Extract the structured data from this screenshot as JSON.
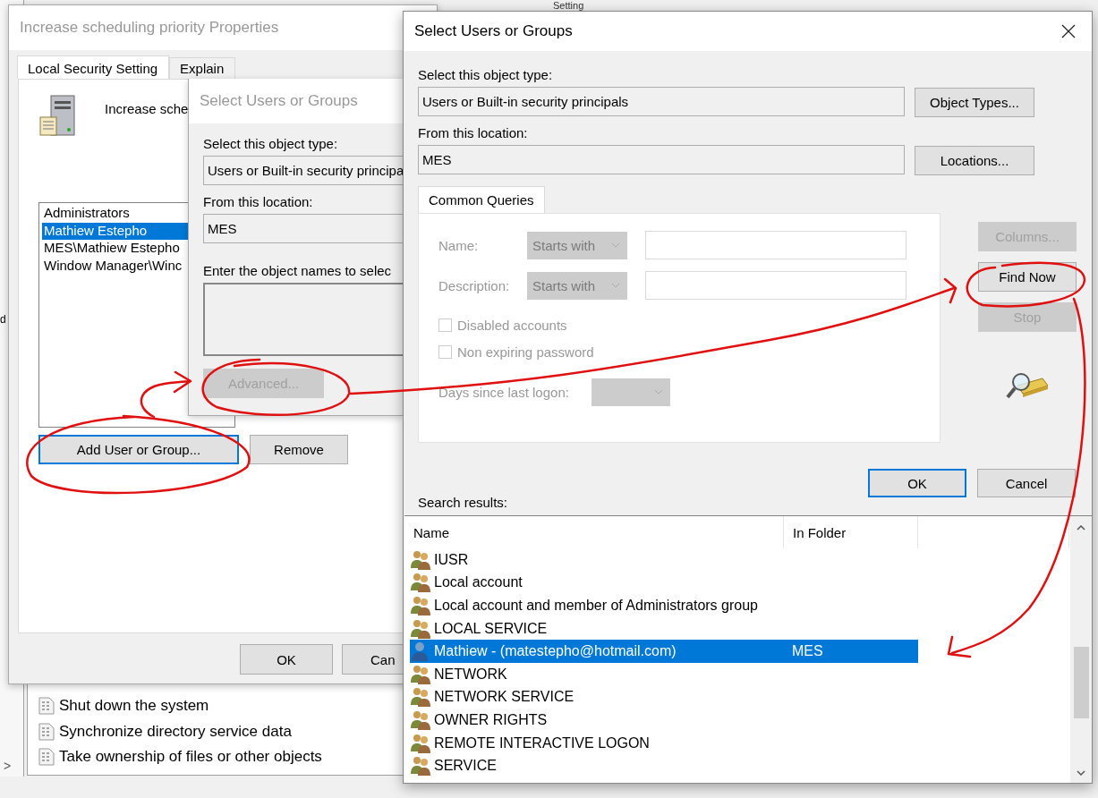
{
  "background": {
    "column_header": "Setting",
    "left_fragment": "d",
    "expand_arrow": ">",
    "policies": [
      "Shut down the system",
      "Synchronize directory service data",
      "Take ownership of files or other objects"
    ]
  },
  "properties": {
    "title": "Increase scheduling priority Properties",
    "tabs": [
      {
        "label": "Local Security Setting",
        "selected": true
      },
      {
        "label": "Explain",
        "selected": false
      }
    ],
    "policy_name": "Increase sche",
    "members": [
      {
        "name": "Administrators",
        "selected": false
      },
      {
        "name": "Mathiew Estepho",
        "selected": true
      },
      {
        "name": "MES\\Mathiew Estepho",
        "selected": false
      },
      {
        "name": "Window Manager\\Winc",
        "selected": false
      }
    ],
    "add_button": "Add User or Group...",
    "remove_button": "Remove",
    "ok_button": "OK",
    "cancel_button": "Can"
  },
  "back_dialog": {
    "title": "Select Users or Groups",
    "object_type_label": "Select this object type:",
    "object_type": "Users or Built-in security principa",
    "location_label": "From this location:",
    "location": "MES",
    "names_label": "Enter the object names to selec",
    "advanced_button": {
      "label": "Advanced...",
      "disabled": true
    }
  },
  "dialog": {
    "title": "Select Users or Groups",
    "object_type_label": "Select this object type:",
    "object_type": "Users or Built-in security principals",
    "object_types_button": "Object Types...",
    "location_label": "From this location:",
    "location": "MES",
    "locations_button": "Locations...",
    "query_tabs": [
      {
        "label": "Common Queries",
        "selected": true
      }
    ],
    "query": {
      "disabled": true,
      "name_label": "Name:",
      "name_match": "Starts with",
      "description_label": "Description:",
      "description_match": "Starts with",
      "checkboxes": [
        {
          "label": "Disabled accounts",
          "checked": false
        },
        {
          "label": "Non expiring password",
          "checked": false
        }
      ],
      "days_label": "Days since last logon:"
    },
    "side_buttons": [
      {
        "label": "Columns...",
        "disabled": true
      },
      {
        "label": "Find Now",
        "disabled": false
      },
      {
        "label": "Stop",
        "disabled": true
      }
    ],
    "ok_button": "OK",
    "cancel_button": "Cancel",
    "results_label": "Search results:",
    "results": {
      "columns": [
        "Name",
        "In Folder"
      ],
      "rows": [
        {
          "name": "IUSR",
          "folder": "",
          "kind": "group",
          "selected": false
        },
        {
          "name": "Local account",
          "folder": "",
          "kind": "group",
          "selected": false
        },
        {
          "name": "Local account and member of Administrators group",
          "folder": "",
          "kind": "group",
          "selected": false
        },
        {
          "name": "LOCAL SERVICE",
          "folder": "",
          "kind": "group",
          "selected": false
        },
        {
          "name": "Mathiew - (matestepho@hotmail.com)",
          "folder": "MES",
          "kind": "user",
          "selected": true
        },
        {
          "name": "NETWORK",
          "folder": "",
          "kind": "group",
          "selected": false
        },
        {
          "name": "NETWORK SERVICE",
          "folder": "",
          "kind": "group",
          "selected": false
        },
        {
          "name": "OWNER RIGHTS",
          "folder": "",
          "kind": "group",
          "selected": false
        },
        {
          "name": "REMOTE INTERACTIVE LOGON",
          "folder": "",
          "kind": "group",
          "selected": false
        },
        {
          "name": "SERVICE",
          "folder": "",
          "kind": "group",
          "selected": false
        }
      ]
    }
  }
}
